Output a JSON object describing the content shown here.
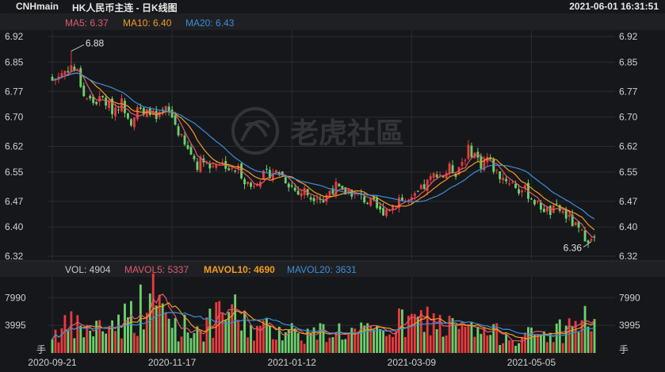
{
  "header": {
    "symbol": "CNHmain",
    "title": "HK人民币主连 - 日K线图",
    "datetime": "2021-06-01 16:31:51"
  },
  "watermark": "老虎社區",
  "legend": {
    "ma5": "MA5: 6.37",
    "ma10": "MA10: 6.40",
    "ma20": "MA20: 6.43",
    "vol": "VOL: 4904",
    "mavol5": "MAVOL5: 5337",
    "mavol10": "MAVOL10: 4690",
    "mavol20": "MAVOL20: 3631"
  },
  "colors": {
    "up": "#ea3a3d",
    "down": "#6ccf6c",
    "ma5": "#e05a6e",
    "ma10": "#f39c1f",
    "ma20": "#3a8fd8",
    "background": "#16171b",
    "grid": "#2a2c31"
  },
  "chart_data": [
    {
      "type": "candlestick",
      "ylim": [
        6.32,
        6.92
      ],
      "y_ticks": [
        "6.92",
        "6.85",
        "6.77",
        "6.70",
        "6.62",
        "6.55",
        "6.47",
        "6.40",
        "6.32"
      ],
      "y_tick_values": [
        6.92,
        6.85,
        6.77,
        6.7,
        6.62,
        6.55,
        6.47,
        6.4,
        6.32
      ],
      "x_ticks": [
        "2020-09-21",
        "2020-11-17",
        "2021-01-12",
        "2021-03-09",
        "2021-05-05"
      ],
      "x_tick_index": [
        0,
        38,
        76,
        114,
        152
      ],
      "annotations": [
        {
          "label": "6.88",
          "index": 6,
          "value": 6.88
        },
        {
          "label": "6.36",
          "index": 171,
          "value": 6.36
        }
      ],
      "close_anchors": [
        [
          0,
          6.8
        ],
        [
          3,
          6.82
        ],
        [
          6,
          6.84
        ],
        [
          8,
          6.82
        ],
        [
          10,
          6.76
        ],
        [
          13,
          6.74
        ],
        [
          16,
          6.75
        ],
        [
          19,
          6.72
        ],
        [
          22,
          6.74
        ],
        [
          25,
          6.69
        ],
        [
          27,
          6.73
        ],
        [
          29,
          6.7
        ],
        [
          31,
          6.72
        ],
        [
          33,
          6.69
        ],
        [
          36,
          6.72
        ],
        [
          38,
          6.7
        ],
        [
          40,
          6.66
        ],
        [
          42,
          6.62
        ],
        [
          44,
          6.6
        ],
        [
          46,
          6.57
        ],
        [
          48,
          6.59
        ],
        [
          50,
          6.56
        ],
        [
          52,
          6.58
        ],
        [
          55,
          6.57
        ],
        [
          57,
          6.55
        ],
        [
          59,
          6.56
        ],
        [
          61,
          6.53
        ],
        [
          63,
          6.51
        ],
        [
          65,
          6.53
        ],
        [
          67,
          6.54
        ],
        [
          70,
          6.55
        ],
        [
          72,
          6.55
        ],
        [
          74,
          6.53
        ],
        [
          76,
          6.51
        ],
        [
          78,
          6.49
        ],
        [
          80,
          6.5
        ],
        [
          82,
          6.48
        ],
        [
          84,
          6.49
        ],
        [
          86,
          6.47
        ],
        [
          88,
          6.5
        ],
        [
          90,
          6.51
        ],
        [
          92,
          6.49
        ],
        [
          94,
          6.5
        ],
        [
          96,
          6.49
        ],
        [
          98,
          6.48
        ],
        [
          100,
          6.47
        ],
        [
          102,
          6.46
        ],
        [
          104,
          6.44
        ],
        [
          106,
          6.45
        ],
        [
          108,
          6.46
        ],
        [
          110,
          6.48
        ],
        [
          112,
          6.47
        ],
        [
          114,
          6.47
        ],
        [
          116,
          6.49
        ],
        [
          118,
          6.51
        ],
        [
          120,
          6.53
        ],
        [
          122,
          6.55
        ],
        [
          124,
          6.54
        ],
        [
          126,
          6.56
        ],
        [
          128,
          6.55
        ],
        [
          130,
          6.58
        ],
        [
          132,
          6.61
        ],
        [
          134,
          6.6
        ],
        [
          136,
          6.57
        ],
        [
          138,
          6.59
        ],
        [
          140,
          6.56
        ],
        [
          142,
          6.54
        ],
        [
          144,
          6.53
        ],
        [
          146,
          6.52
        ],
        [
          148,
          6.5
        ],
        [
          150,
          6.5
        ],
        [
          152,
          6.48
        ],
        [
          154,
          6.46
        ],
        [
          156,
          6.45
        ],
        [
          158,
          6.44
        ],
        [
          160,
          6.45
        ],
        [
          162,
          6.44
        ],
        [
          164,
          6.42
        ],
        [
          166,
          6.4
        ],
        [
          168,
          6.38
        ],
        [
          170,
          6.37
        ],
        [
          171,
          6.36
        ],
        [
          172,
          6.37
        ]
      ],
      "candle_count": 173,
      "last_ma": {
        "ma5": 6.37,
        "ma10": 6.4,
        "ma20": 6.43
      }
    },
    {
      "type": "bar",
      "ylim": [
        0,
        11000
      ],
      "y_ticks": [
        "7990",
        "3995",
        "手"
      ],
      "y_tick_values": [
        7990,
        3995,
        0
      ],
      "volume_anchors": [
        [
          0,
          3200
        ],
        [
          6,
          4200
        ],
        [
          12,
          3600
        ],
        [
          18,
          4500
        ],
        [
          24,
          5800
        ],
        [
          28,
          7200
        ],
        [
          31,
          9100
        ],
        [
          34,
          7500
        ],
        [
          38,
          4800
        ],
        [
          42,
          4100
        ],
        [
          46,
          4000
        ],
        [
          50,
          4600
        ],
        [
          54,
          5800
        ],
        [
          56,
          7600
        ],
        [
          58,
          6200
        ],
        [
          62,
          4300
        ],
        [
          66,
          3600
        ],
        [
          70,
          3900
        ],
        [
          74,
          4200
        ],
        [
          78,
          3200
        ],
        [
          82,
          3000
        ],
        [
          86,
          3400
        ],
        [
          90,
          3800
        ],
        [
          94,
          3200
        ],
        [
          98,
          3300
        ],
        [
          102,
          3000
        ],
        [
          106,
          3900
        ],
        [
          110,
          4600
        ],
        [
          114,
          4800
        ],
        [
          118,
          5200
        ],
        [
          120,
          5600
        ],
        [
          124,
          4300
        ],
        [
          128,
          3900
        ],
        [
          132,
          3500
        ],
        [
          136,
          3400
        ],
        [
          140,
          3000
        ],
        [
          144,
          3100
        ],
        [
          148,
          2600
        ],
        [
          152,
          2800
        ],
        [
          156,
          3000
        ],
        [
          160,
          3500
        ],
        [
          164,
          4200
        ],
        [
          168,
          5200
        ],
        [
          172,
          4904
        ]
      ],
      "last": {
        "vol": 4904,
        "mavol5": 5337,
        "mavol10": 4690,
        "mavol20": 3631
      }
    }
  ]
}
